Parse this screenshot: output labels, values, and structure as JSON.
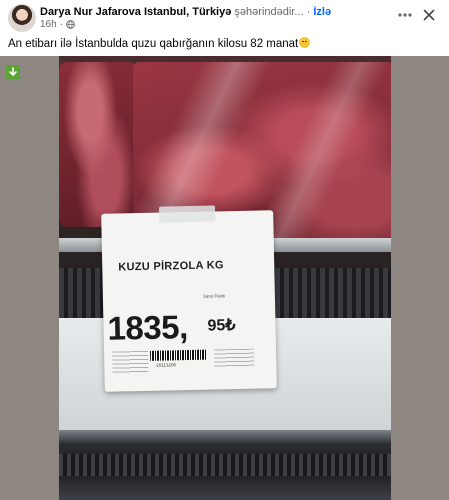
{
  "post": {
    "author": "Darya Nur Jafarova Istanbul, Türkiyə",
    "location_text": "şəhərindədir...",
    "separator": "·",
    "follow_label": "İzlə",
    "time": "16h",
    "caption": "An etibarı ilə İstanbulda quzu qabırğanın kilosu 82 manat"
  },
  "icons": {
    "more": "more-icon",
    "close": "close-icon",
    "globe": "globe-icon",
    "download": "download-icon",
    "emoji": "grinning-emoji"
  },
  "price_tag": {
    "product": "KUZU PİRZOLA KG",
    "sub_label": "Satış Fiyatı",
    "price_whole": "1835,",
    "price_decimal": "95₺",
    "barcode_number": "20113206"
  },
  "colors": {
    "link": "#0866ff",
    "secondary_text": "#65676b",
    "download_badge": "#5aa532"
  }
}
